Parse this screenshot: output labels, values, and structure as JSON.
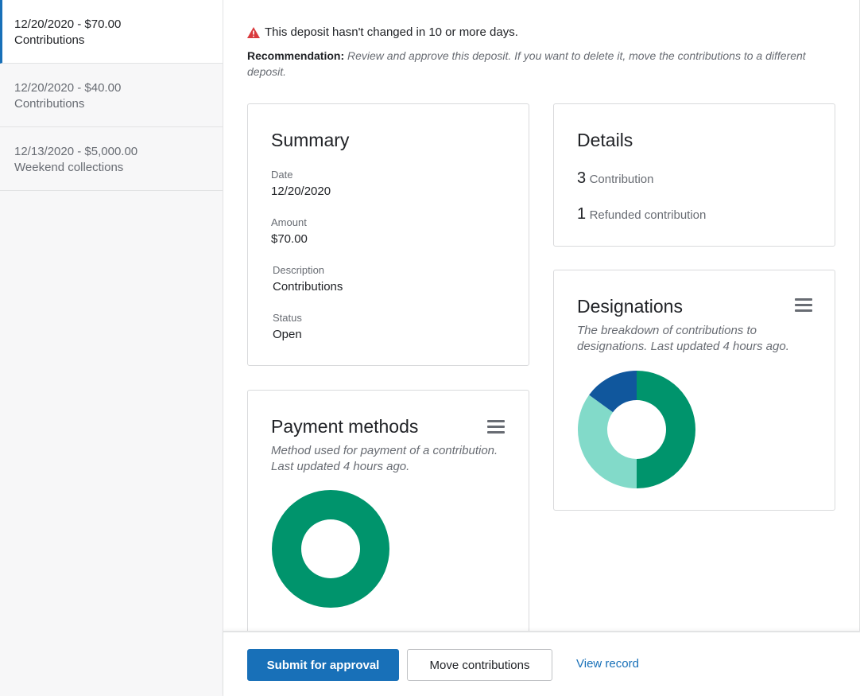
{
  "sidebar": {
    "items": [
      {
        "line1": "12/20/2020 - $70.00",
        "line2": "Contributions"
      },
      {
        "line1": "12/20/2020 - $40.00",
        "line2": "Contributions"
      },
      {
        "line1": "12/13/2020 - $5,000.00",
        "line2": "Weekend collections"
      }
    ]
  },
  "alert": {
    "message": "This deposit hasn't changed in 10 or more days.",
    "icon": "warning-triangle",
    "color": "#d93a3d"
  },
  "recommendation": {
    "label": "Recommendation:",
    "text": "Review and approve this deposit. If you want to delete it, move the contributions to a different deposit."
  },
  "summary": {
    "title": "Summary",
    "fields": [
      {
        "label": "Date",
        "value": "12/20/2020"
      },
      {
        "label": "Amount",
        "value": "$70.00"
      },
      {
        "label": "Description",
        "value": "Contributions"
      },
      {
        "label": "Status",
        "value": "Open"
      }
    ]
  },
  "details": {
    "title": "Details",
    "rows": [
      {
        "count": "3",
        "label": "Contribution"
      },
      {
        "count": "1",
        "label": "Refunded contribution"
      }
    ]
  },
  "designations": {
    "title": "Designations",
    "description": "The breakdown of contributions to designations. Last updated 4 hours ago.",
    "chart": {
      "type": "pie",
      "variant": "donut",
      "slices": [
        {
          "value": 0.5,
          "color": "#00946c"
        },
        {
          "value": 0.35,
          "color": "#82dac9"
        },
        {
          "value": 0.15,
          "color": "#10579d"
        }
      ]
    }
  },
  "payment_methods": {
    "title": "Payment methods",
    "description": "Method used for payment of a contribution. Last updated 4 hours ago.",
    "chart": {
      "type": "pie",
      "variant": "donut",
      "slices": [
        {
          "value": 1.0,
          "color": "#00946c"
        }
      ]
    }
  },
  "footer": {
    "submit_label": "Submit for approval",
    "move_label": "Move contributions",
    "view_label": "View record"
  },
  "colors": {
    "primary": "#1870b8",
    "border": "#d9dadc",
    "muted_text": "#686c73"
  }
}
